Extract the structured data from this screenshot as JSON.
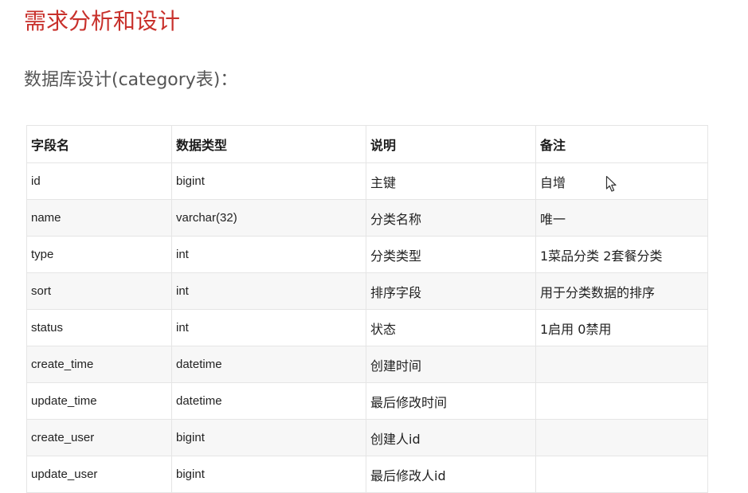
{
  "doc": {
    "title": "需求分析和设计",
    "subtitle": "数据库设计(category表)："
  },
  "table": {
    "headers": [
      "字段名",
      "数据类型",
      "说明",
      "备注"
    ],
    "rows": [
      [
        "id",
        "bigint",
        "主键",
        "自增"
      ],
      [
        "name",
        "varchar(32)",
        "分类名称",
        "唯一"
      ],
      [
        "type",
        "int",
        "分类类型",
        "1菜品分类 2套餐分类"
      ],
      [
        "sort",
        "int",
        "排序字段",
        "用于分类数据的排序"
      ],
      [
        "status",
        "int",
        "状态",
        "1启用 0禁用"
      ],
      [
        "create_time",
        "datetime",
        "创建时间",
        ""
      ],
      [
        "update_time",
        "datetime",
        "最后修改时间",
        ""
      ],
      [
        "create_user",
        "bigint",
        "创建人id",
        ""
      ],
      [
        "update_user",
        "bigint",
        "最后修改人id",
        ""
      ]
    ]
  },
  "icons": {
    "cursor": "mouse-pointer-icon"
  }
}
